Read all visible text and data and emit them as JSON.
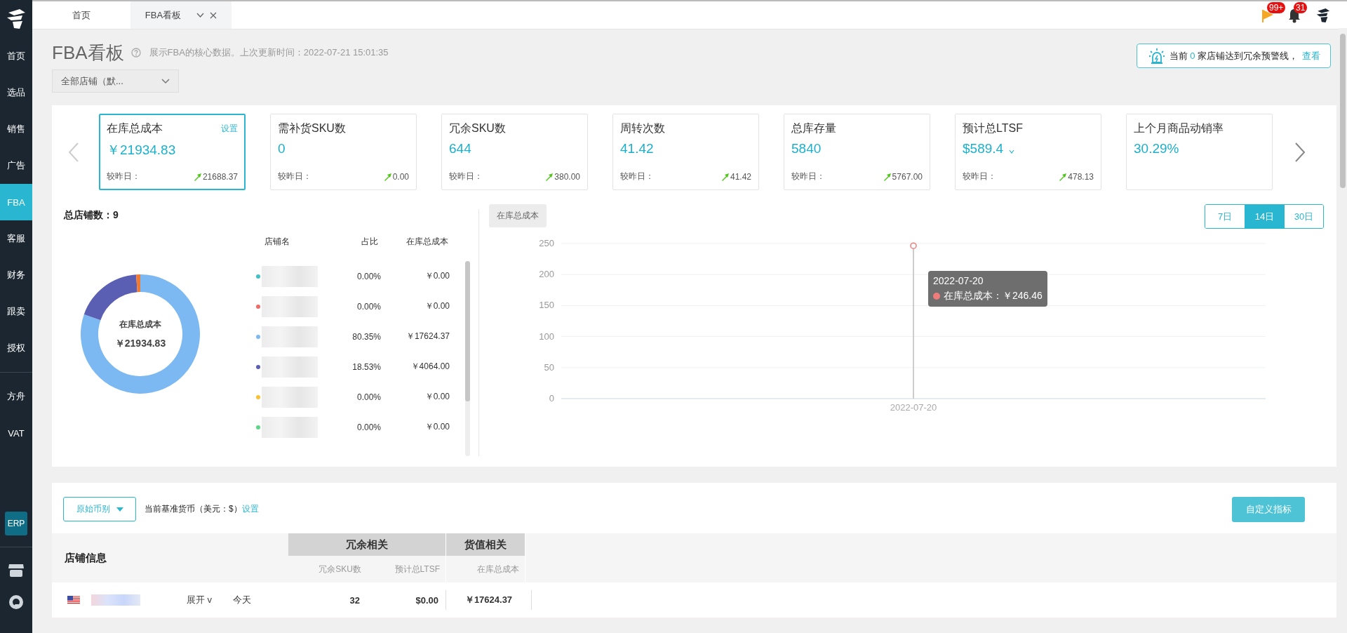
{
  "sidebar": {
    "items": [
      {
        "label": "首页",
        "selected": false
      },
      {
        "label": "选品",
        "selected": false
      },
      {
        "label": "销售",
        "selected": false
      },
      {
        "label": "广告",
        "selected": false
      },
      {
        "label": "FBA",
        "selected": true
      },
      {
        "label": "客服",
        "selected": false
      },
      {
        "label": "财务",
        "selected": false
      },
      {
        "label": "跟卖",
        "selected": false
      },
      {
        "label": "授权",
        "selected": false
      },
      {
        "label": "方舟",
        "selected": false
      },
      {
        "label": "VAT",
        "selected": false
      }
    ],
    "erp_badge": "ERP"
  },
  "tabs": [
    {
      "label": "首页",
      "selected": false,
      "closable": false
    },
    {
      "label": "FBA看板",
      "selected": true,
      "closable": true
    }
  ],
  "top_bar": {
    "flag_badge": "99+",
    "bell_badge": "31"
  },
  "header": {
    "title": "FBA看板",
    "subtitle": "展示FBA的核心数据。上次更新时间：2022-07-21 15:01:35",
    "store_select": "全部店铺（默..."
  },
  "alert": {
    "prefix": "当前",
    "count": "0",
    "suffix": "家店铺达到冗余预警线，",
    "link": "查看"
  },
  "kpi_cards": [
    {
      "title": "在库总成本",
      "value": "￥21934.83",
      "selected": true,
      "action": "设置",
      "dropdown": false,
      "delta_label": "较昨日：",
      "delta": "21688.37"
    },
    {
      "title": "需补货SKU数",
      "value": "0",
      "selected": false,
      "dropdown": false,
      "delta_label": "较昨日：",
      "delta": "0.00"
    },
    {
      "title": "冗余SKU数",
      "value": "644",
      "selected": false,
      "dropdown": false,
      "delta_label": "较昨日：",
      "delta": "380.00"
    },
    {
      "title": "周转次数",
      "value": "41.42",
      "selected": false,
      "dropdown": false,
      "delta_label": "较昨日：",
      "delta": "41.42"
    },
    {
      "title": "总库存量",
      "value": "5840",
      "selected": false,
      "dropdown": false,
      "delta_label": "较昨日：",
      "delta": "5767.00"
    },
    {
      "title": "预计总LTSF",
      "value": "$589.4",
      "selected": false,
      "dropdown": true,
      "delta_label": "较昨日：",
      "delta": "478.13"
    },
    {
      "title": "上个月商品动销率",
      "value": "30.29%",
      "selected": false,
      "dropdown": false
    }
  ],
  "store_summary": {
    "title": "总店铺数：9",
    "donut_value": "￥21934.83",
    "chart_data": {
      "type": "donut",
      "series": [
        {
          "name": "在库总成本",
          "values": [
            0,
            0,
            80.35,
            18.53,
            0,
            0,
            1.12
          ]
        }
      ]
    },
    "columns": [
      "店铺名",
      "占比",
      "在库总成本"
    ],
    "rows": [
      {
        "color": "#3fc2c9",
        "share": "0.00%",
        "cost": "￥0.00"
      },
      {
        "color": "#f06a6a",
        "share": "0.00%",
        "cost": "￥0.00"
      },
      {
        "color": "#7cb9f2",
        "share": "80.35%",
        "cost": "￥17624.37"
      },
      {
        "color": "#5b5fb3",
        "share": "18.53%",
        "cost": "￥4064.00"
      },
      {
        "color": "#fbc12f",
        "share": "0.00%",
        "cost": "￥0.00"
      },
      {
        "color": "#5dd68a",
        "share": "0.00%",
        "cost": "￥0.00"
      }
    ]
  },
  "trend": {
    "ranges": [
      {
        "label": "7日",
        "selected": false
      },
      {
        "label": "14日",
        "selected": true
      },
      {
        "label": "30日",
        "selected": false
      }
    ],
    "chart_data": {
      "type": "line",
      "x": [
        "2022-07-20"
      ],
      "series": [
        {
          "name": "在库总成本",
          "color": "#f07b7b",
          "marker": true,
          "values": [
            246.46
          ]
        }
      ],
      "ylim": [
        0,
        250
      ],
      "yticks": [
        0,
        50,
        100,
        150,
        200,
        250
      ],
      "grid": true
    },
    "tooltip": {
      "date": "2022-07-20",
      "label": "在库总成本：￥246.46"
    }
  },
  "detail": {
    "currency_select": "原始币别",
    "base_currency": "当前基准货币（美元：$）",
    "base_link": "设置",
    "custom_button": "自定义指标",
    "info_header": "店铺信息",
    "groups": [
      {
        "label": "冗余相关",
        "columns": [
          "冗余SKU数",
          "预计总LTSF"
        ]
      },
      {
        "label": "货值相关",
        "columns": [
          "在库总成本"
        ]
      }
    ],
    "rows": [
      {
        "expand": "展开 v",
        "day": "今天",
        "excess_sku": "32",
        "ltsf": "$0.00",
        "cost": "￥17624.37"
      }
    ]
  }
}
